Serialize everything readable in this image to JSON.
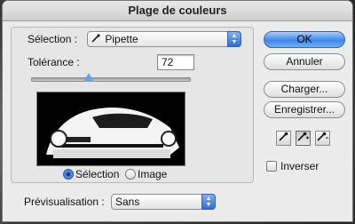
{
  "dialog": {
    "title": "Plage de couleurs"
  },
  "selection": {
    "label": "Sélection :",
    "value": "Pipette"
  },
  "tolerance": {
    "label": "Tolérance :",
    "value": "72",
    "slider_fraction": 0.36
  },
  "view_mode": {
    "options": [
      "Sélection",
      "Image"
    ],
    "selected": "Sélection"
  },
  "preview_mode": {
    "label": "Prévisualisation :",
    "value": "Sans"
  },
  "buttons": {
    "ok": "OK",
    "cancel": "Annuler",
    "load": "Charger...",
    "save": "Enregistrer..."
  },
  "eyedroppers": [
    "eyedropper",
    "eyedropper-plus",
    "eyedropper-minus"
  ],
  "invert": {
    "label": "Inverser",
    "checked": false
  },
  "colors": {
    "accent": "#3f86e6"
  }
}
